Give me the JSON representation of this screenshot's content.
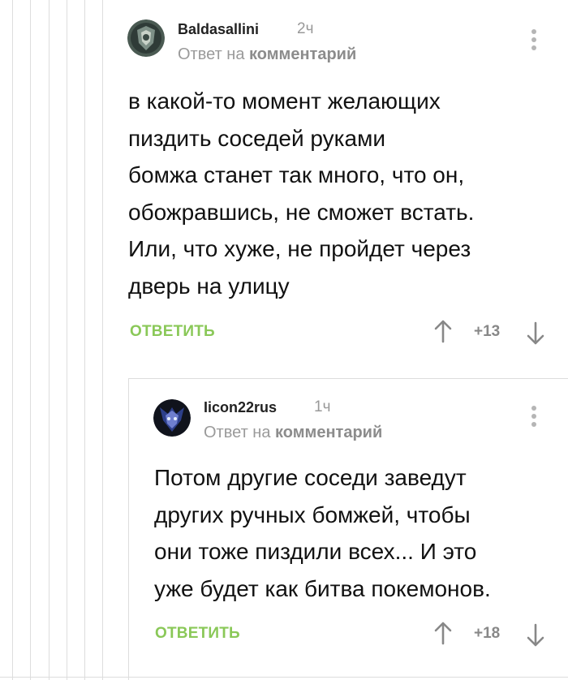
{
  "comments": [
    {
      "username": "Baldasallini",
      "time": "2ч",
      "reply_prefix": "Ответ на",
      "reply_link": "комментарий",
      "avatar_icon": "shield-emblem-avatar",
      "lines": [
        "в какой-то момент желающих",
        "пиздить соседей руками",
        "бомжа станет так много, что он,",
        "обожравшись, не сможет встать.",
        "Или, что хуже, не пройдет через",
        "дверь на улицу"
      ],
      "reply_label": "ОТВЕТИТЬ",
      "rating": "+13"
    },
    {
      "username": "Iicon22rus",
      "time": "1ч",
      "reply_prefix": "Ответ на",
      "reply_link": "комментарий",
      "avatar_icon": "dark-mask-avatar",
      "lines": [
        "Потом другие соседи заведут",
        "других ручных бомжей, чтобы",
        "они тоже пиздили всех... И это",
        "уже будет как битва покемонов."
      ],
      "reply_label": "ОТВЕТИТЬ",
      "rating": "+18"
    }
  ],
  "colors": {
    "accent": "#8ac858",
    "meta": "#999999",
    "thread_line": "#dddddd"
  }
}
